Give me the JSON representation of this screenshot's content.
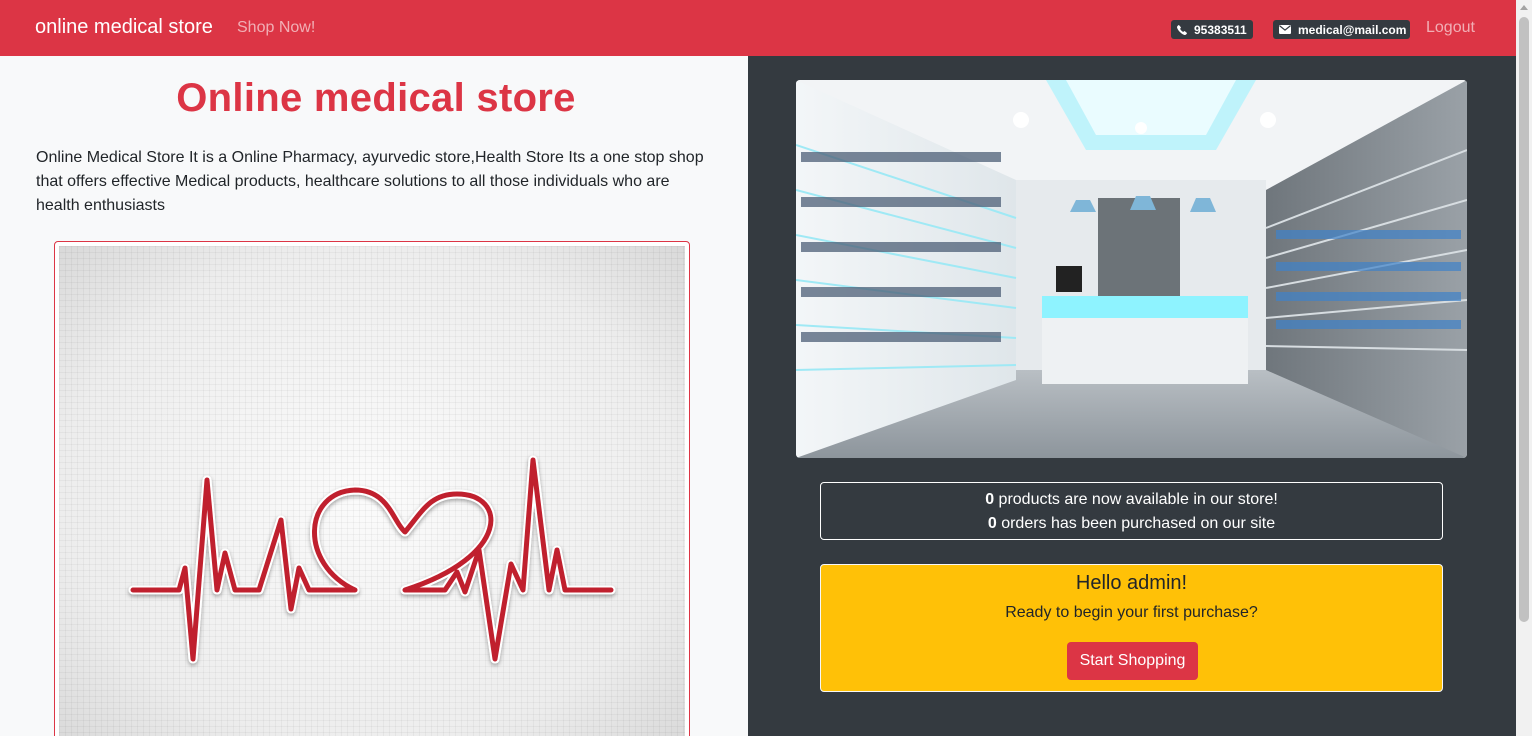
{
  "navbar": {
    "brand": "online medical store",
    "shop_link": "Shop Now!",
    "phone": "95383511",
    "email": "medical@mail.com",
    "logout": "Logout",
    "phone_icon": "phone-icon",
    "email_icon": "envelope-icon"
  },
  "main": {
    "headline": "Online medical store",
    "intro": "Online Medical Store It is a Online Pharmacy, ayurvedic store,Health Store Its a one stop shop that offers effective Medical products, healthcare solutions to all those individuals who are health enthusiasts"
  },
  "stats": {
    "products_count": "0",
    "products_text": " products are now available in our store!",
    "orders_count": "0",
    "orders_text": " orders has been purchased on our site"
  },
  "welcome": {
    "title": "Hello admin!",
    "subtitle": "Ready to begin your first purchase?",
    "button": "Start Shopping"
  },
  "colors": {
    "brand": "#dc3545",
    "dark": "#343a40",
    "warning": "#ffc107",
    "light": "#f8f9fa"
  }
}
